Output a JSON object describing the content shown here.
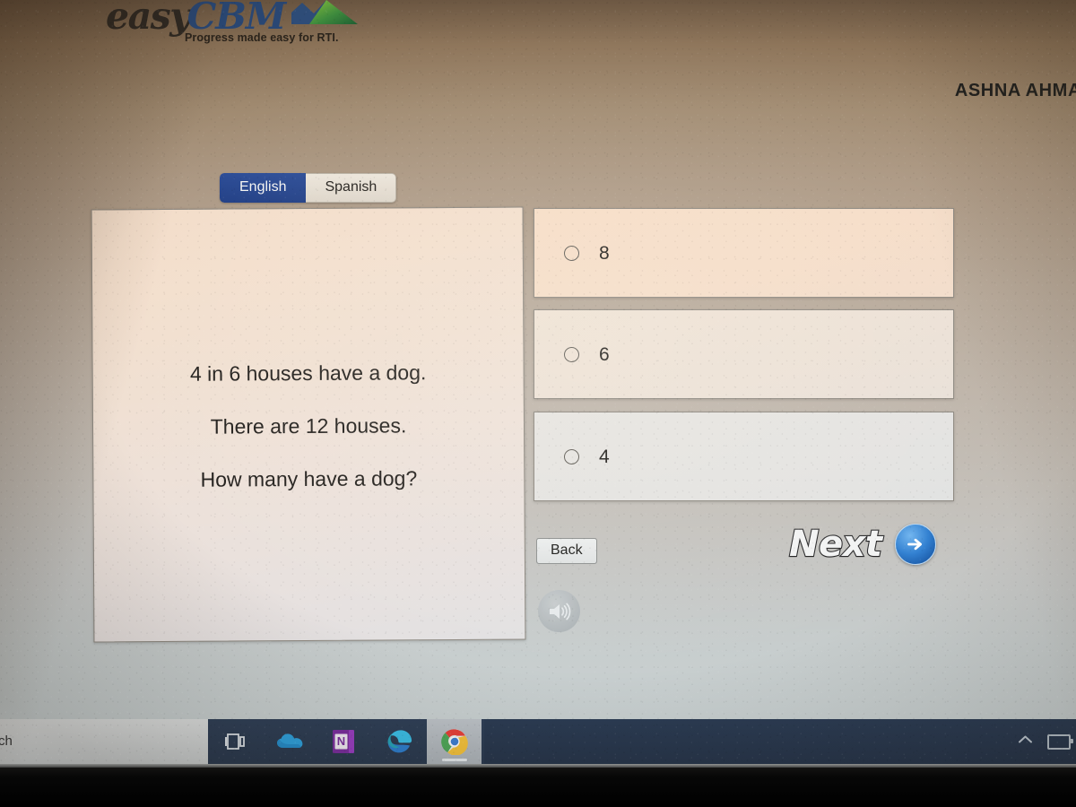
{
  "app": {
    "logo_easy": "easy",
    "logo_cbm": "CBM",
    "logo_icon": "mountain-chart-icon",
    "tagline": "Progress made easy for RTI.",
    "student_name": "ASHNA AHMA"
  },
  "language_tabs": {
    "items": [
      {
        "label": "English",
        "active": true
      },
      {
        "label": "Spanish",
        "active": false
      }
    ]
  },
  "question": {
    "lines": [
      "4 in 6 houses have a dog.",
      "There are 12 houses.",
      "How many have a dog?"
    ]
  },
  "answers": {
    "options": [
      {
        "label": "8",
        "selected": false
      },
      {
        "label": "6",
        "selected": false
      },
      {
        "label": "4",
        "selected": false
      }
    ]
  },
  "navigation": {
    "back_label": "Back",
    "next_label": "Next",
    "next_icon": "arrow-right-circle-icon",
    "audio_icon": "speaker-volume-icon"
  },
  "taskbar": {
    "search_text": "ch",
    "icons": [
      {
        "name": "task-view-icon",
        "label": "Task View"
      },
      {
        "name": "onedrive-icon",
        "label": "OneDrive"
      },
      {
        "name": "onenote-icon",
        "label": "OneNote",
        "glyph": "N"
      },
      {
        "name": "edge-icon",
        "label": "Microsoft Edge"
      },
      {
        "name": "chrome-icon",
        "label": "Google Chrome"
      }
    ],
    "tray": {
      "chevron_icon": "chevron-up-icon",
      "battery_icon": "battery-icon"
    }
  },
  "colors": {
    "tab_active_bg": "#2a4b96",
    "tab_inactive_bg": "#ece5da",
    "next_arrow_blue": "#2f7fd1",
    "taskbar_bg": "#2f4058",
    "panel_border": "#8d8880"
  }
}
